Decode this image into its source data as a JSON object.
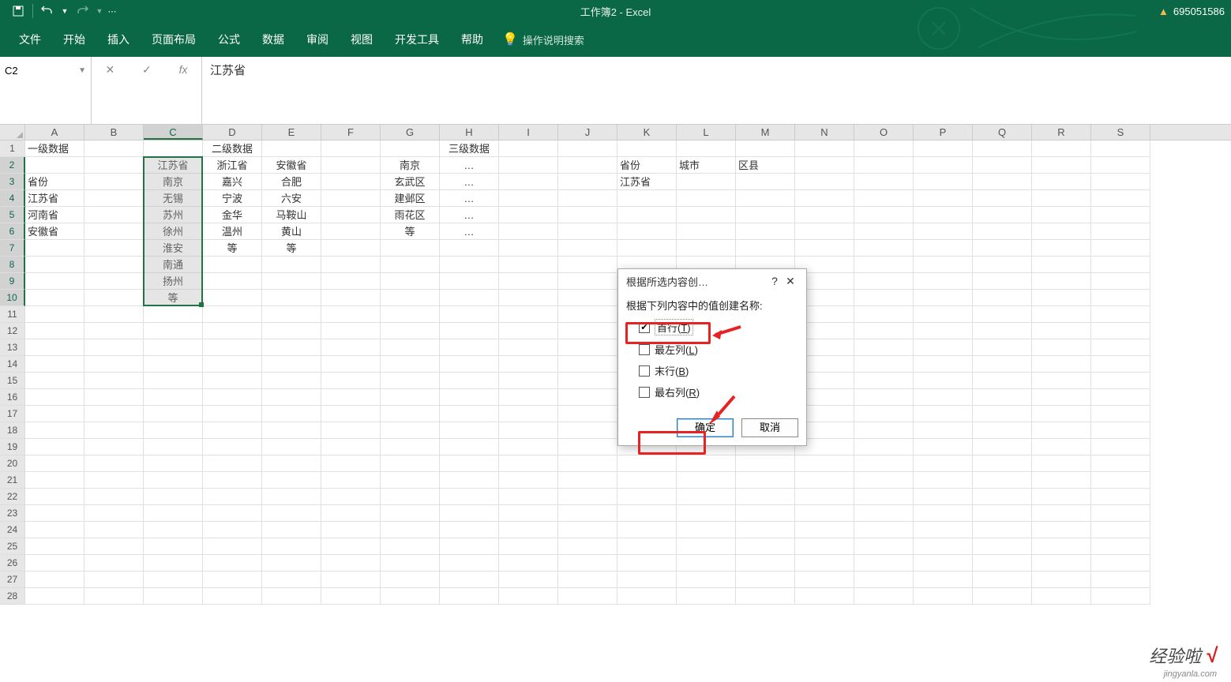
{
  "titlebar": {
    "doc_title": "工作簿2 - Excel",
    "username": "695051586"
  },
  "qat": {
    "save_tip": "save-icon",
    "undo_tip": "undo-icon",
    "redo_tip": "redo-icon"
  },
  "ribbon": {
    "tabs": [
      "文件",
      "开始",
      "插入",
      "页面布局",
      "公式",
      "数据",
      "审阅",
      "视图",
      "开发工具",
      "帮助"
    ],
    "tell_me": "操作说明搜索"
  },
  "formula": {
    "name_box": "C2",
    "value": "江苏省"
  },
  "columns": [
    "A",
    "B",
    "C",
    "D",
    "E",
    "F",
    "G",
    "H",
    "I",
    "J",
    "K",
    "L",
    "M",
    "N",
    "O",
    "P",
    "Q",
    "R",
    "S"
  ],
  "rows": 28,
  "cells": {
    "A1": {
      "v": "一级数据",
      "a": "left"
    },
    "D1": {
      "v": "二级数据",
      "a": "center"
    },
    "H1": {
      "v": "三级数据",
      "a": "center"
    },
    "C2": {
      "v": "江苏省",
      "a": "center"
    },
    "D2": {
      "v": "浙江省",
      "a": "center"
    },
    "E2": {
      "v": "安徽省",
      "a": "center"
    },
    "G2": {
      "v": "南京",
      "a": "center"
    },
    "H2": {
      "v": "…",
      "a": "center"
    },
    "K2": {
      "v": "省份",
      "a": "left"
    },
    "L2": {
      "v": "城市",
      "a": "left"
    },
    "M2": {
      "v": "区县",
      "a": "left"
    },
    "A3": {
      "v": "省份",
      "a": "left"
    },
    "C3": {
      "v": "南京",
      "a": "center"
    },
    "D3": {
      "v": "嘉兴",
      "a": "center"
    },
    "E3": {
      "v": "合肥",
      "a": "center"
    },
    "G3": {
      "v": "玄武区",
      "a": "center"
    },
    "H3": {
      "v": "…",
      "a": "center"
    },
    "K3": {
      "v": "江苏省",
      "a": "left"
    },
    "A4": {
      "v": "江苏省",
      "a": "left"
    },
    "C4": {
      "v": "无锡",
      "a": "center"
    },
    "D4": {
      "v": "宁波",
      "a": "center"
    },
    "E4": {
      "v": "六安",
      "a": "center"
    },
    "G4": {
      "v": "建邺区",
      "a": "center"
    },
    "H4": {
      "v": "…",
      "a": "center"
    },
    "A5": {
      "v": "河南省",
      "a": "left"
    },
    "C5": {
      "v": "苏州",
      "a": "center"
    },
    "D5": {
      "v": "金华",
      "a": "center"
    },
    "E5": {
      "v": "马鞍山",
      "a": "center"
    },
    "G5": {
      "v": "雨花区",
      "a": "center"
    },
    "H5": {
      "v": "…",
      "a": "center"
    },
    "A6": {
      "v": "安徽省",
      "a": "left"
    },
    "C6": {
      "v": "徐州",
      "a": "center"
    },
    "D6": {
      "v": "温州",
      "a": "center"
    },
    "E6": {
      "v": "黄山",
      "a": "center"
    },
    "G6": {
      "v": "等",
      "a": "center"
    },
    "H6": {
      "v": "…",
      "a": "center"
    },
    "C7": {
      "v": "淮安",
      "a": "center"
    },
    "D7": {
      "v": "等",
      "a": "center"
    },
    "E7": {
      "v": "等",
      "a": "center"
    },
    "C8": {
      "v": "南通",
      "a": "center"
    },
    "C9": {
      "v": "扬州",
      "a": "center"
    },
    "C10": {
      "v": "等",
      "a": "center"
    }
  },
  "dialog": {
    "title": "根据所选内容创…",
    "label": "根据下列内容中的值创建名称:",
    "opt_top": "首行(",
    "opt_top_mn": "T",
    "opt_top_end": ")",
    "opt_left": "最左列(",
    "opt_left_mn": "L",
    "opt_left_end": ")",
    "opt_bottom": "末行(",
    "opt_bottom_mn": "B",
    "opt_bottom_end": ")",
    "opt_right": "最右列(",
    "opt_right_mn": "R",
    "opt_right_end": ")",
    "ok": "确定",
    "cancel": "取消"
  },
  "watermark": {
    "main": "经验啦",
    "sub": "jingyanla.com"
  }
}
